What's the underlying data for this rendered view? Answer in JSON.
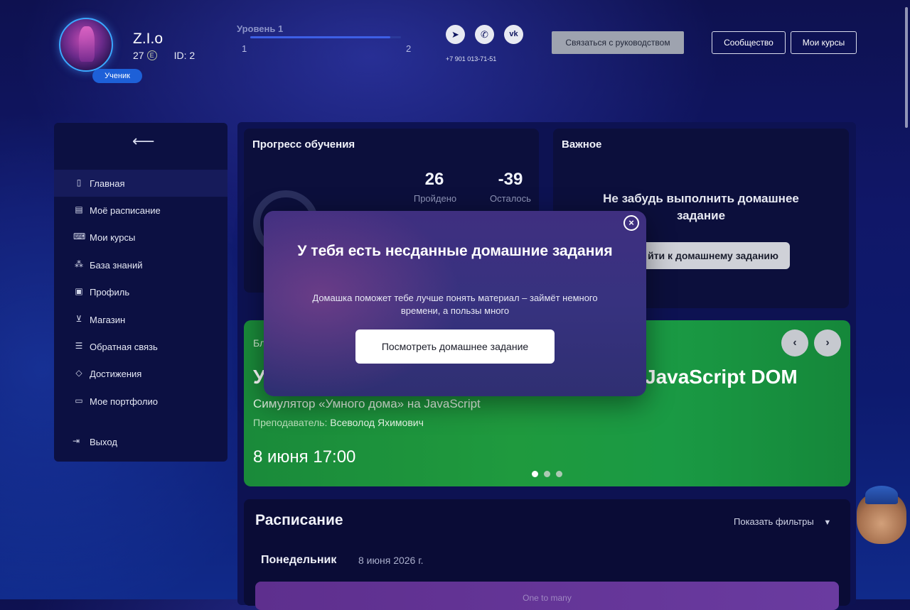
{
  "user": {
    "name": "Z.I.o",
    "coins": "27",
    "coin_icon_letter": "E",
    "id_label": "ID: 2",
    "role": "Ученик"
  },
  "level": {
    "label": "Уровень 1",
    "current": "1",
    "next": "2",
    "progress_fraction": 0.93
  },
  "contacts": {
    "phone": "+7 901 013-71-51",
    "social": [
      "telegram-icon",
      "whatsapp-icon",
      "vk-icon"
    ]
  },
  "header_buttons": {
    "contact_manager": "Связаться с руководством",
    "community": "Сообщество",
    "my_courses": "Мои курсы"
  },
  "sidebar": {
    "items": [
      {
        "label": "Главная",
        "icon": "bookmark-icon"
      },
      {
        "label": "Моё расписание",
        "icon": "calendar-icon"
      },
      {
        "label": "Мои курсы",
        "icon": "code-icon"
      },
      {
        "label": "База знаний",
        "icon": "hierarchy-icon"
      },
      {
        "label": "Профиль",
        "icon": "profile-icon"
      },
      {
        "label": "Магазин",
        "icon": "cart-icon"
      },
      {
        "label": "Обратная связь",
        "icon": "feedback-icon"
      },
      {
        "label": "Достижения",
        "icon": "diamond-icon"
      },
      {
        "label": "Мое портфолио",
        "icon": "briefcase-icon"
      }
    ],
    "logout": "Выход"
  },
  "progress": {
    "title": "Прогресс обучения",
    "done_value": "26",
    "done_label": "Пройдено",
    "left_value": "-39",
    "left_label": "Осталось"
  },
  "important": {
    "title": "Важное",
    "text": "Не забудь выполнить домашнее задание",
    "button_visible": "йти к домашнему заданию"
  },
  "banner": {
    "label_partial": "Бл",
    "title_partial_left": "У",
    "title_partial_right": "JavaScript DOM",
    "subtitle": "Симулятор «Умного дома» на JavaScript",
    "teacher_label": "Преподаватель:",
    "teacher_name": "Всеволод Яхимович",
    "date": "8 июня  17:00",
    "prev": "‹",
    "next": "›"
  },
  "schedule": {
    "title": "Расписание",
    "filters": "Показать фильтры",
    "day": "Понедельник",
    "date": "8 июня 2026 г.",
    "lesson_partial": "One to many"
  },
  "modal": {
    "title": "У тебя есть несданные домашние задания",
    "text": "Домашка поможет тебе лучше понять материал – займёт немного времени, а пользы много",
    "button": "Посмотреть домашнее задание",
    "close": "×"
  }
}
